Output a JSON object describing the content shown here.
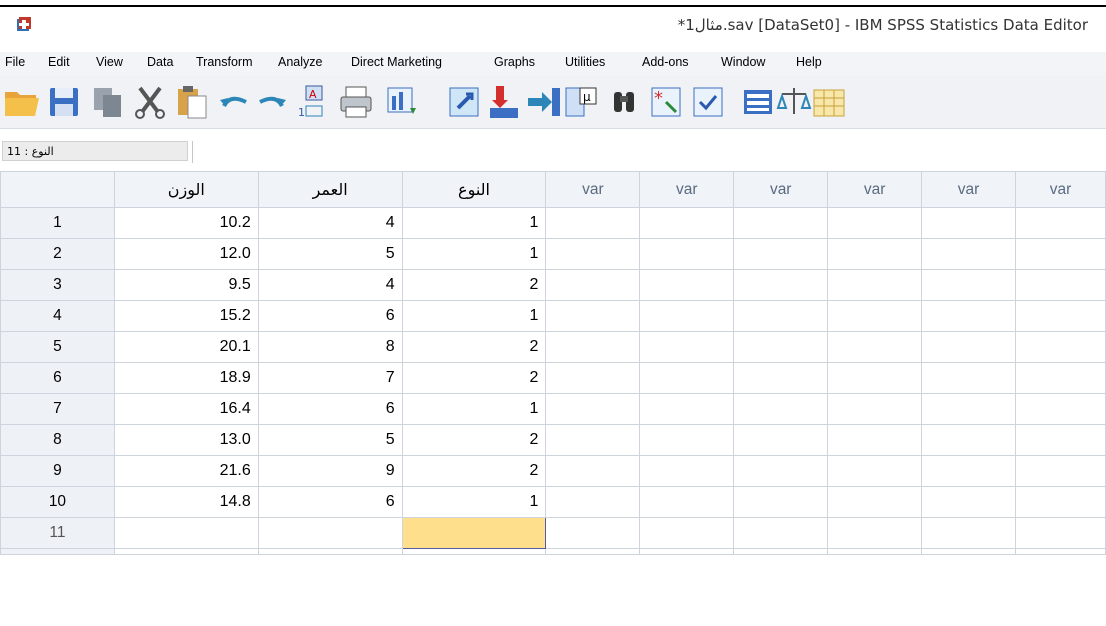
{
  "window": {
    "title": "*مثال1.sav [DataSet0] - IBM SPSS Statistics Data Editor",
    "icon": "spss-app-icon"
  },
  "menu": [
    "File",
    "Edit",
    "View",
    "Data",
    "Transform",
    "Analyze",
    "Direct Marketing",
    "Graphs",
    "Utilities",
    "Add-ons",
    "Window",
    "Help"
  ],
  "toolbar": {
    "icons": [
      "open-folder-icon",
      "save-icon",
      "copy-icon",
      "cut-icon",
      "paste-icon",
      "undo-icon",
      "redo-icon",
      "sort-icon",
      "print-icon",
      "data-view-icon",
      "goto-case-icon",
      "insert-case-icon",
      "insert-variable-icon",
      "variable-info-icon",
      "find-icon",
      "split-file-icon",
      "weight-cases-icon",
      "value-labels-icon",
      "scale-icon",
      "grid-icon"
    ]
  },
  "cell_editor": {
    "name": "11 : النوع",
    "value": ""
  },
  "grid": {
    "columns": [
      "الوزن",
      "العمر",
      "النوع",
      "var",
      "var",
      "var",
      "var",
      "var",
      "var"
    ],
    "rows": [
      {
        "n": "1",
        "c": [
          "10.2",
          "4",
          "1"
        ]
      },
      {
        "n": "2",
        "c": [
          "12.0",
          "5",
          "1"
        ]
      },
      {
        "n": "3",
        "c": [
          "9.5",
          "4",
          "2"
        ]
      },
      {
        "n": "4",
        "c": [
          "15.2",
          "6",
          "1"
        ]
      },
      {
        "n": "5",
        "c": [
          "20.1",
          "8",
          "2"
        ]
      },
      {
        "n": "6",
        "c": [
          "18.9",
          "7",
          "2"
        ]
      },
      {
        "n": "7",
        "c": [
          "16.4",
          "6",
          "1"
        ]
      },
      {
        "n": "8",
        "c": [
          "13.0",
          "5",
          "2"
        ]
      },
      {
        "n": "9",
        "c": [
          "21.6",
          "9",
          "2"
        ]
      },
      {
        "n": "10",
        "c": [
          "14.8",
          "6",
          "1"
        ]
      },
      {
        "n": "11",
        "c": [
          "",
          "",
          ""
        ]
      }
    ],
    "selected_color": "#fedf8c"
  }
}
